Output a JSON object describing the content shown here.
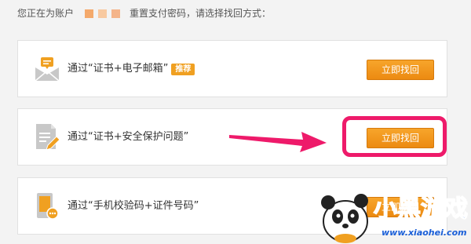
{
  "header": {
    "prefix": "您正在为账户",
    "suffix": "重置支付密码，请选择找回方式："
  },
  "methods": [
    {
      "label": "通过“证书+电子邮箱”",
      "badge": "推荐",
      "button": "立即找回",
      "icon": "envelope-icon"
    },
    {
      "label": "通过“证书+安全保护问题”",
      "button": "立即找回",
      "icon": "document-pen-icon"
    },
    {
      "label": "通过“手机校验码+证件号码”",
      "button": "立即找回",
      "icon": "phone-icon"
    }
  ],
  "watermark": {
    "title": "小黑游戏",
    "url": "www.xiaohei.com"
  },
  "colors": {
    "accent": "#f0a021",
    "highlight": "#ee1a6a",
    "masked": [
      "#f4a96b",
      "#f8c9a0",
      "#f4b48a"
    ]
  }
}
